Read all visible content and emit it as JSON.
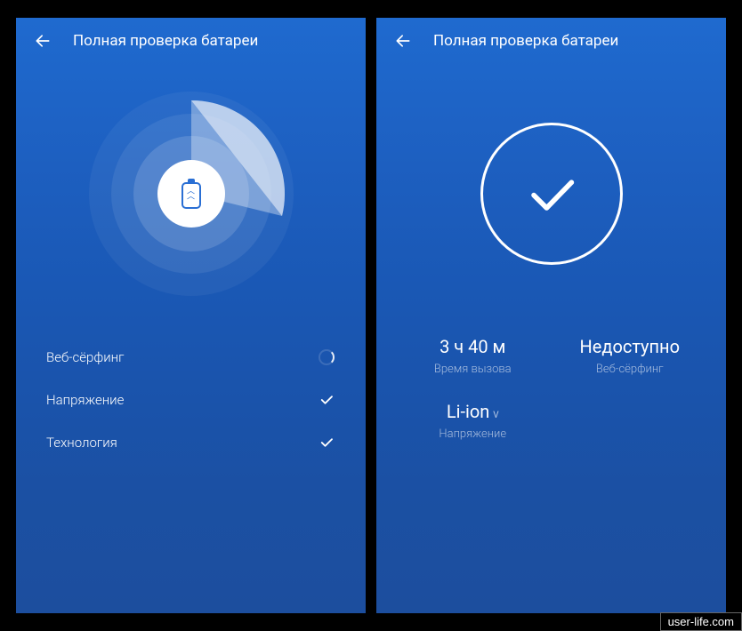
{
  "left": {
    "title": "Полная проверка батареи",
    "items": [
      {
        "label": "Веб-сёрфинг",
        "status": "loading"
      },
      {
        "label": "Напряжение",
        "status": "done"
      },
      {
        "label": "Технология",
        "status": "done"
      }
    ]
  },
  "right": {
    "title": "Полная проверка батареи",
    "stats": [
      {
        "value": "3 ч 40 м",
        "label": "Время вызова"
      },
      {
        "value": "Недоступно",
        "label": "Веб-сёрфинг"
      },
      {
        "value": "Li-ion",
        "sub": "V",
        "label": "Напряжение"
      }
    ]
  },
  "watermark": "user-life.com"
}
